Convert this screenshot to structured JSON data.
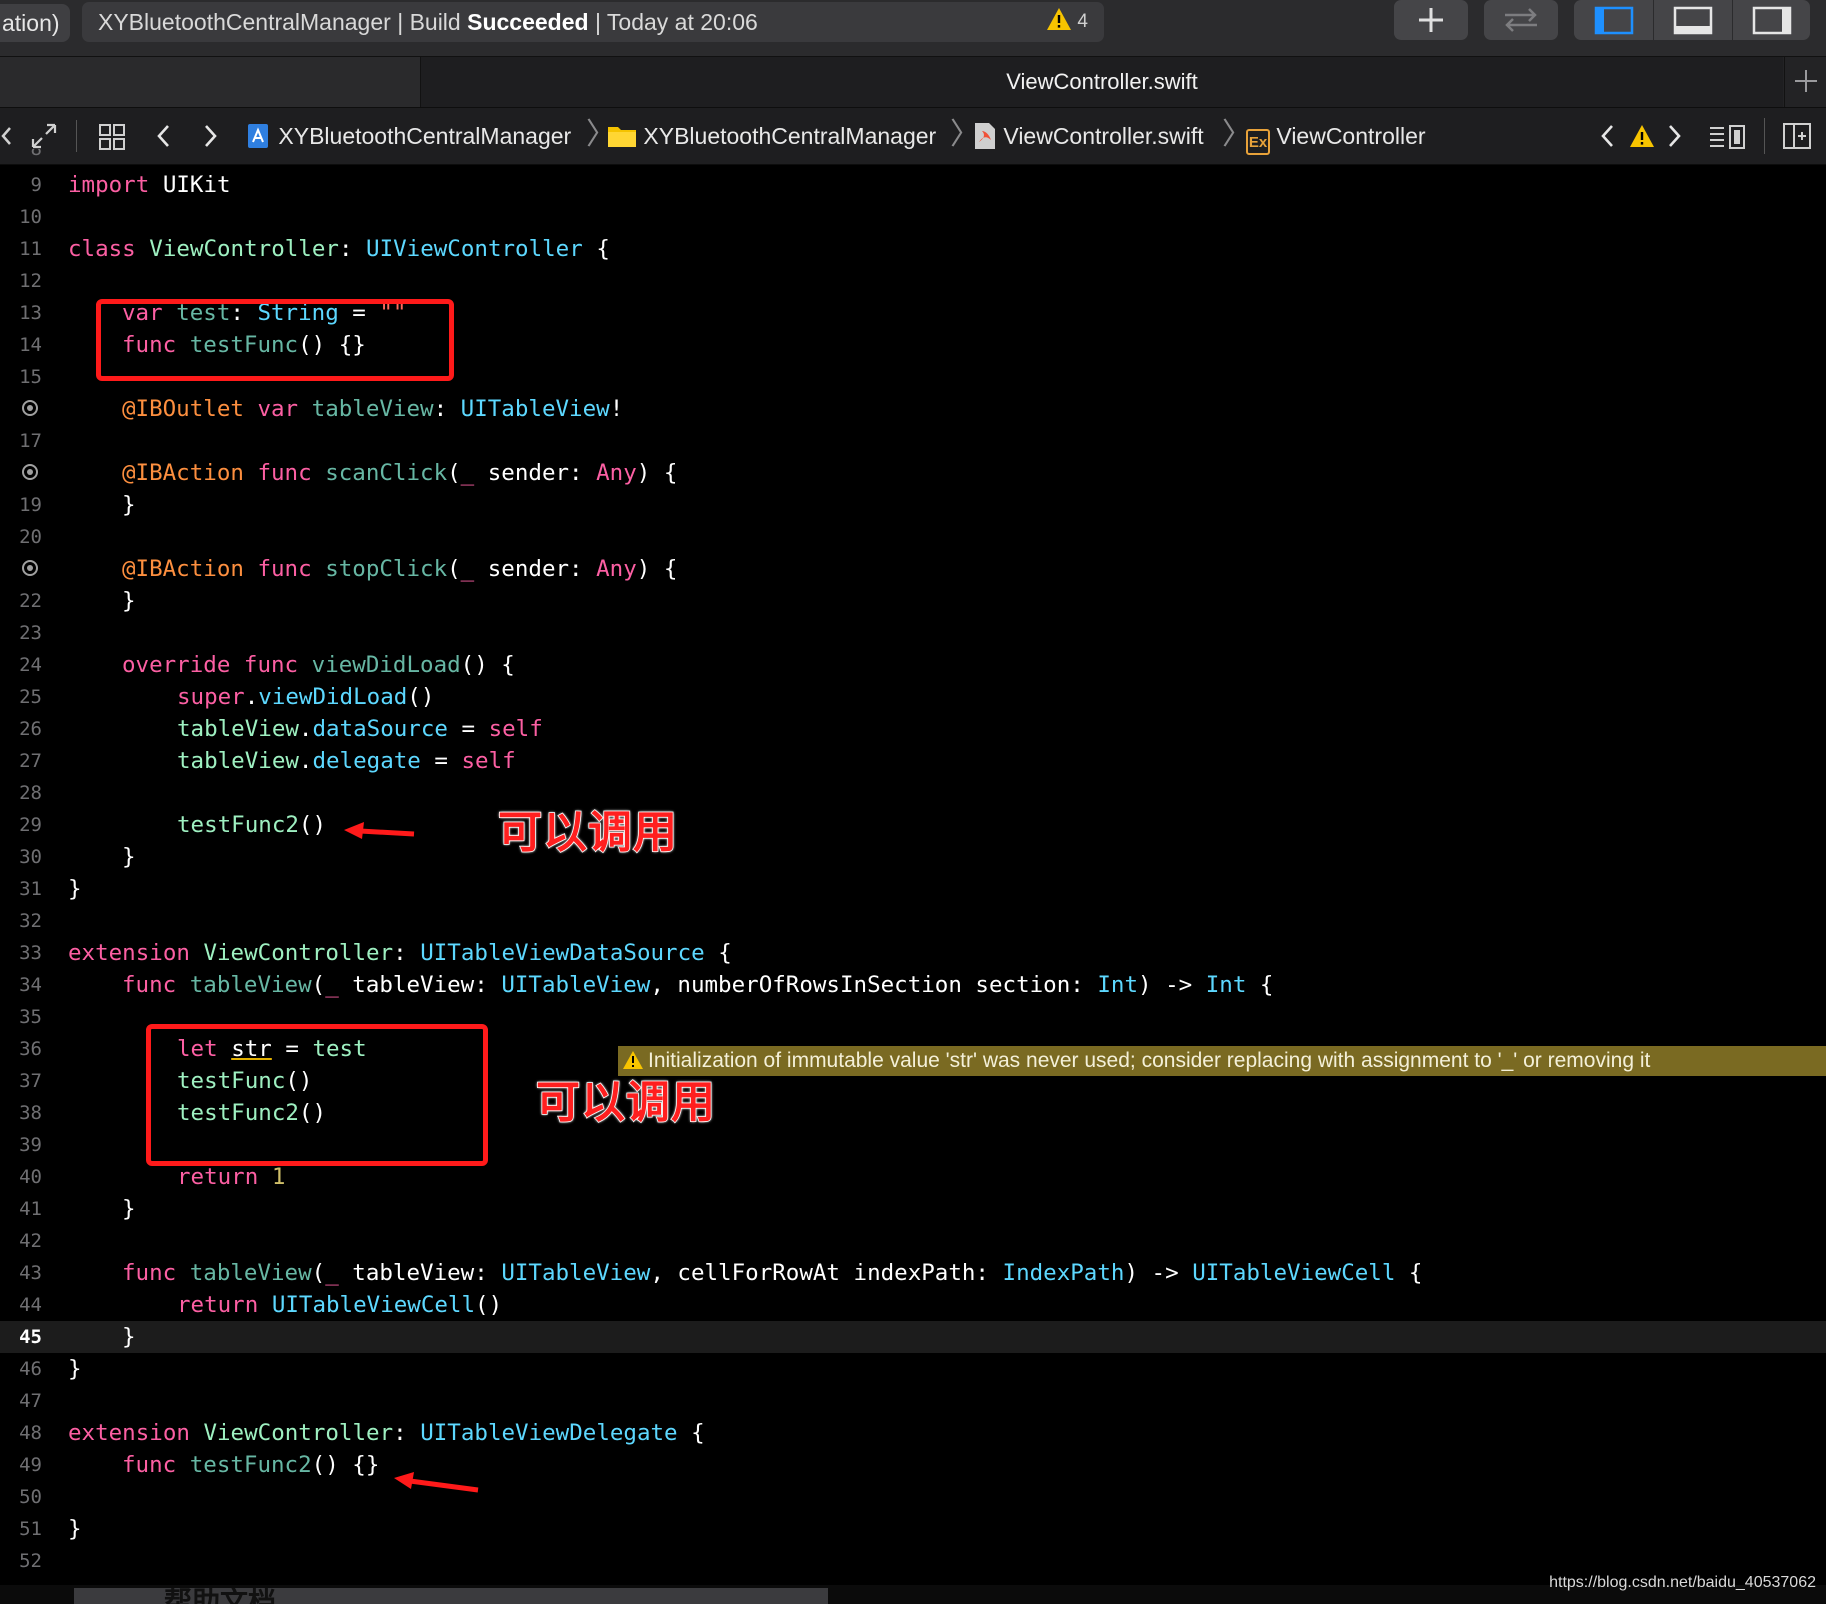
{
  "toolbar": {
    "scheme_fragment": "ation)",
    "activity_project": "XYBluetoothCentralManager",
    "activity_separator": "|",
    "activity_build_prefix": "Build",
    "activity_build_status": "Succeeded",
    "activity_time": "Today at 20:06",
    "warning_count": "4",
    "add_icon": "plus-icon",
    "swap_icon": "swap-arrows-icon"
  },
  "tab": {
    "title": "ViewController.swift",
    "add_icon": "plus-icon"
  },
  "jumpbar": {
    "crumbs": [
      {
        "label": "XYBluetoothCentralManager",
        "icon": "project-icon"
      },
      {
        "label": "XYBluetoothCentralManager",
        "icon": "folder-icon"
      },
      {
        "label": "ViewController.swift",
        "icon": "swift-file-icon"
      },
      {
        "label": "ViewController",
        "icon": "extension-icon",
        "badge": "Ex"
      }
    ],
    "separator": "〉"
  },
  "editor": {
    "current_line": "45",
    "lines": [
      {
        "n": "9"
      },
      {
        "n": "10"
      },
      {
        "n": "11"
      },
      {
        "n": "12"
      },
      {
        "n": "13"
      },
      {
        "n": "14"
      },
      {
        "n": "15"
      },
      {
        "n": "16"
      },
      {
        "n": "17"
      },
      {
        "n": "18"
      },
      {
        "n": "19"
      },
      {
        "n": "20"
      },
      {
        "n": "21"
      },
      {
        "n": "22"
      },
      {
        "n": "23"
      },
      {
        "n": "24"
      },
      {
        "n": "25"
      },
      {
        "n": "26"
      },
      {
        "n": "27"
      },
      {
        "n": "28"
      },
      {
        "n": "29"
      },
      {
        "n": "30"
      },
      {
        "n": "31"
      },
      {
        "n": "32"
      },
      {
        "n": "33"
      },
      {
        "n": "34"
      },
      {
        "n": "35"
      },
      {
        "n": "36"
      },
      {
        "n": "37"
      },
      {
        "n": "38"
      },
      {
        "n": "39"
      },
      {
        "n": "40"
      },
      {
        "n": "41"
      },
      {
        "n": "42"
      },
      {
        "n": "43"
      },
      {
        "n": "44"
      },
      {
        "n": "45"
      },
      {
        "n": "46"
      },
      {
        "n": "47"
      },
      {
        "n": "48"
      },
      {
        "n": "49"
      },
      {
        "n": "50"
      },
      {
        "n": "51"
      },
      {
        "n": "52"
      }
    ],
    "code": {
      "l9": [
        "import",
        " UIKit"
      ],
      "l11": [
        "class",
        " ",
        "ViewController",
        ": ",
        "UIViewController",
        " {"
      ],
      "l13": [
        "var",
        " ",
        "test",
        ": ",
        "String",
        " = ",
        "\"\""
      ],
      "l14": [
        "func",
        " ",
        "testFunc",
        "() {}"
      ],
      "l16": [
        "@IBOutlet",
        " ",
        "var",
        " ",
        "tableView",
        ": ",
        "UITableView",
        "!"
      ],
      "l18": [
        "@IBAction",
        " ",
        "func",
        " ",
        "scanClick",
        "(",
        "_",
        " sender: ",
        "Any",
        ") {"
      ],
      "l19": [
        "}"
      ],
      "l21": [
        "@IBAction",
        " ",
        "func",
        " ",
        "stopClick",
        "(",
        "_",
        " sender: ",
        "Any",
        ") {"
      ],
      "l22": [
        "}"
      ],
      "l24": [
        "override",
        " ",
        "func",
        " ",
        "viewDidLoad",
        "() {"
      ],
      "l25": [
        "super",
        ".",
        "viewDidLoad",
        "()"
      ],
      "l26": [
        "tableView",
        ".",
        "dataSource",
        " = ",
        "self"
      ],
      "l27": [
        "tableView",
        ".",
        "delegate",
        " = ",
        "self"
      ],
      "l29": [
        "testFunc2",
        "()"
      ],
      "l30": [
        "}"
      ],
      "l31": [
        "}"
      ],
      "l33": [
        "extension",
        " ",
        "ViewController",
        ": ",
        "UITableViewDataSource",
        " {"
      ],
      "l34": [
        "func",
        " ",
        "tableView",
        "(",
        "_",
        " tableView: ",
        "UITableView",
        ", numberOfRowsInSection section: ",
        "Int",
        ") -> ",
        "Int",
        " {"
      ],
      "l36": [
        "let",
        " ",
        "str",
        " = ",
        "test"
      ],
      "l37": [
        "testFunc",
        "()"
      ],
      "l38": [
        "testFunc2",
        "()"
      ],
      "l40": [
        "return",
        " ",
        "1"
      ],
      "l41": [
        "}"
      ],
      "l43": [
        "func",
        " ",
        "tableView",
        "(",
        "_",
        " tableView: ",
        "UITableView",
        ", cellForRowAt indexPath: ",
        "IndexPath",
        ") -> ",
        "UITableViewCell",
        " {"
      ],
      "l44": [
        "return",
        " ",
        "UITableViewCell",
        "()"
      ],
      "l45": [
        "}"
      ],
      "l46": [
        "}"
      ],
      "l48": [
        "extension",
        " ",
        "ViewController",
        ": ",
        "UITableViewDelegate",
        " {"
      ],
      "l49": [
        "func",
        " ",
        "testFunc2",
        "() {}"
      ],
      "l51": [
        "}"
      ]
    },
    "warning_message": "Initialization of immutable value 'str' was never used; consider replacing with assignment to '_' or removing it"
  },
  "annotations": {
    "note_1": "可以调用",
    "note_2": "可以调用",
    "color": "#ff1a1a"
  },
  "bottom_panel_label": "帮助文档",
  "watermark": "https://blog.csdn.net/baidu_40537062",
  "colors": {
    "keyword": "#fc5fa3",
    "type": "#5dd8ff",
    "project_symbol": "#9ef0c1",
    "project_func": "#67b7a4",
    "string": "#fc6a5d",
    "number": "#d0bf69",
    "attribute": "#fd8f3f",
    "warning_bg": "#7a6a22"
  }
}
